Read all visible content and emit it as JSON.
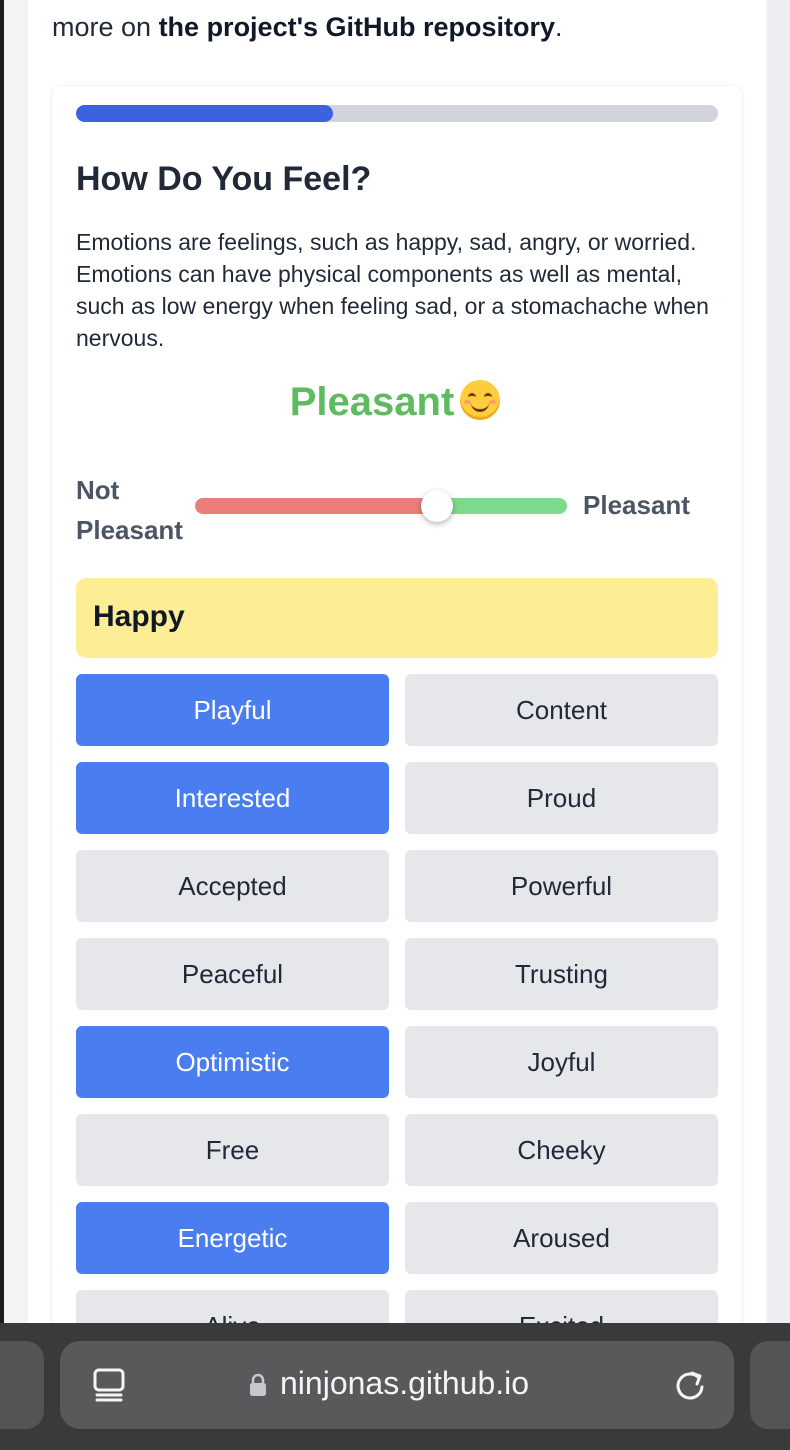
{
  "intro": {
    "prefix": "more on ",
    "link": "the project's GitHub repository",
    "suffix": "."
  },
  "progress": {
    "value": 0.4
  },
  "question": {
    "title": "How Do You Feel?",
    "description": "Emotions are feelings, such as happy, sad, angry, or worried. Emotions can have physical components as well as mental, such as low energy when feeling sad, or a stomachache when nervous."
  },
  "mood": {
    "label": "Pleasant",
    "emoji_icon": "smiling-face-icon",
    "color": "#5fbb5f"
  },
  "slider": {
    "left_label": "Not Pleasant",
    "right_label": "Pleasant",
    "value": 0.65,
    "left_color": "#ea7c7a",
    "right_color": "#7fd98a"
  },
  "category": {
    "label": "Happy",
    "color": "#fdee96"
  },
  "emotions": [
    {
      "label": "Playful",
      "selected": true
    },
    {
      "label": "Content",
      "selected": false
    },
    {
      "label": "Interested",
      "selected": true
    },
    {
      "label": "Proud",
      "selected": false
    },
    {
      "label": "Accepted",
      "selected": false
    },
    {
      "label": "Powerful",
      "selected": false
    },
    {
      "label": "Peaceful",
      "selected": false
    },
    {
      "label": "Trusting",
      "selected": false
    },
    {
      "label": "Optimistic",
      "selected": true
    },
    {
      "label": "Joyful",
      "selected": false
    },
    {
      "label": "Free",
      "selected": false
    },
    {
      "label": "Cheeky",
      "selected": false
    },
    {
      "label": "Energetic",
      "selected": true
    },
    {
      "label": "Aroused",
      "selected": false
    },
    {
      "label": "Alive",
      "selected": false
    },
    {
      "label": "Excited",
      "selected": false
    }
  ],
  "colors": {
    "selected_chip": "#4a7df0",
    "unselected_chip": "#e5e7eb",
    "progress_fill": "#3b63e0"
  },
  "browser": {
    "url": "ninjonas.github.io",
    "tabs_icon": "tabs-overview-icon",
    "lock_icon": "lock-icon",
    "reload_icon": "reload-icon"
  }
}
